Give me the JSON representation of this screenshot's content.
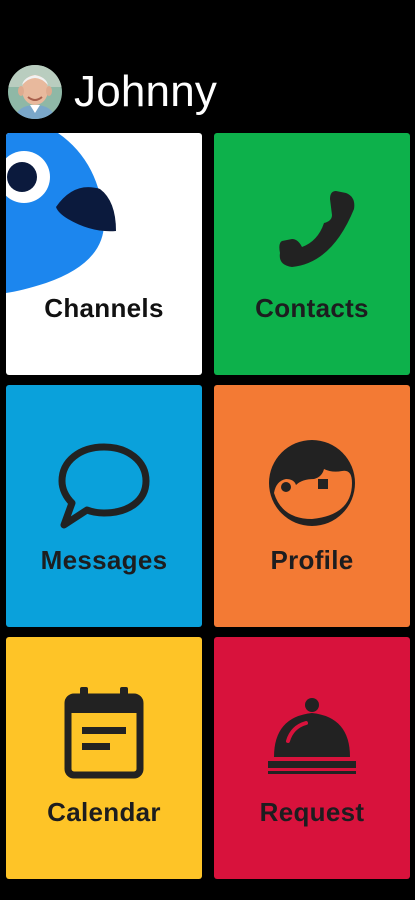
{
  "user": {
    "name": "Johnny"
  },
  "tiles": [
    {
      "id": "channels",
      "label": "Channels",
      "color": "#ffffff",
      "icon": "bird-icon"
    },
    {
      "id": "contacts",
      "label": "Contacts",
      "color": "#0db14b",
      "icon": "phone-icon"
    },
    {
      "id": "messages",
      "label": "Messages",
      "color": "#0aa1db",
      "icon": "chat-bubble-icon"
    },
    {
      "id": "profile",
      "label": "Profile",
      "color": "#f37a34",
      "icon": "face-icon"
    },
    {
      "id": "calendar",
      "label": "Calendar",
      "color": "#fec427",
      "icon": "calendar-icon"
    },
    {
      "id": "request",
      "label": "Request",
      "color": "#d8123c",
      "icon": "service-bell-icon"
    }
  ],
  "colors": {
    "background": "#000000",
    "icon_dark": "#222222"
  }
}
